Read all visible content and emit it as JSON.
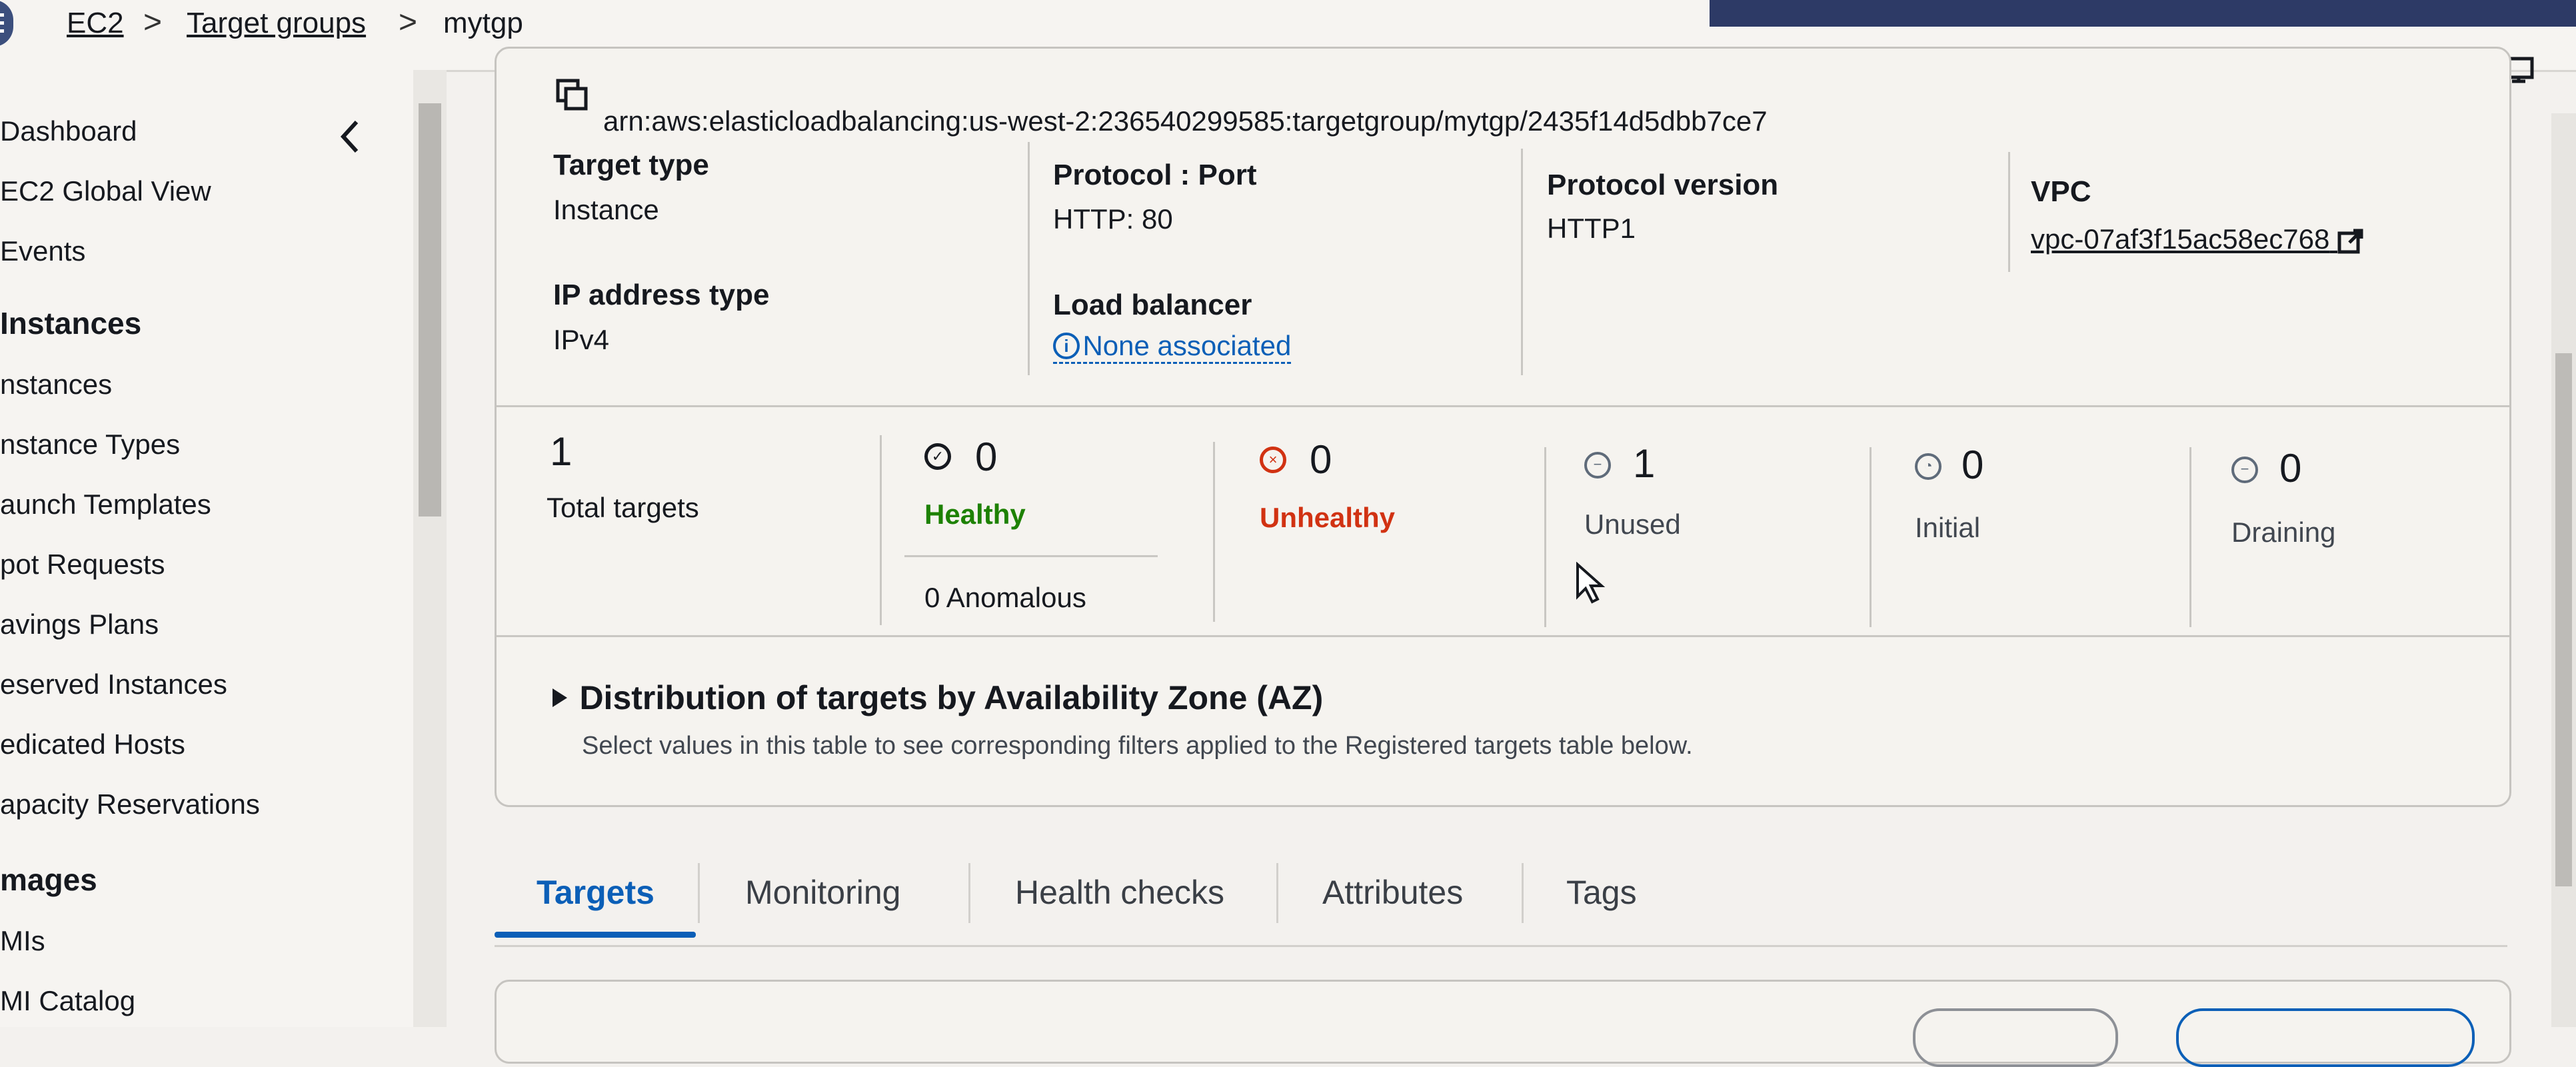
{
  "breadcrumb": {
    "ec2": "EC2",
    "target_groups": "Target groups",
    "current": "mytgp",
    "sep": ">"
  },
  "sidebar": {
    "items": [
      {
        "label": "Dashboard"
      },
      {
        "label": "EC2 Global View"
      },
      {
        "label": "Events"
      },
      {
        "label": "Instances",
        "heading": true
      },
      {
        "label": "nstances"
      },
      {
        "label": "nstance Types"
      },
      {
        "label": "aunch Templates"
      },
      {
        "label": "pot Requests"
      },
      {
        "label": "avings Plans"
      },
      {
        "label": "eserved Instances"
      },
      {
        "label": "edicated Hosts"
      },
      {
        "label": "apacity Reservations"
      },
      {
        "label": "mages",
        "heading": true
      },
      {
        "label": "MIs"
      },
      {
        "label": "MI Catalog"
      }
    ]
  },
  "details": {
    "arn": "arn:aws:elasticloadbalancing:us-west-2:236540299585:targetgroup/mytgp/2435f14d5dbb7ce7",
    "target_type_label": "Target type",
    "target_type_value": "Instance",
    "protocol_port_label": "Protocol : Port",
    "protocol_port_value": "HTTP: 80",
    "protocol_version_label": "Protocol version",
    "protocol_version_value": "HTTP1",
    "vpc_label": "VPC",
    "vpc_value": "vpc-07af3f15ac58ec768",
    "ip_type_label": "IP address type",
    "ip_type_value": "IPv4",
    "lb_label": "Load balancer",
    "lb_value": "None associated"
  },
  "stats": {
    "total": {
      "count": "1",
      "label": "Total targets"
    },
    "healthy": {
      "count": "0",
      "label": "Healthy",
      "anomalous": "0 Anomalous"
    },
    "unhealthy": {
      "count": "0",
      "label": "Unhealthy"
    },
    "unused": {
      "count": "1",
      "label": "Unused"
    },
    "initial": {
      "count": "0",
      "label": "Initial"
    },
    "draining": {
      "count": "0",
      "label": "Draining"
    }
  },
  "distribution": {
    "title": "Distribution of targets by Availability Zone (AZ)",
    "description": "Select values in this table to see corresponding filters applied to the Registered targets table below."
  },
  "tabs": [
    "Targets",
    "Monitoring",
    "Health checks",
    "Attributes",
    "Tags"
  ],
  "colors": {
    "accent": "#0b5fb7",
    "healthy": "#1d8102",
    "unhealthy": "#d13212",
    "navy": "#2d3a66"
  }
}
